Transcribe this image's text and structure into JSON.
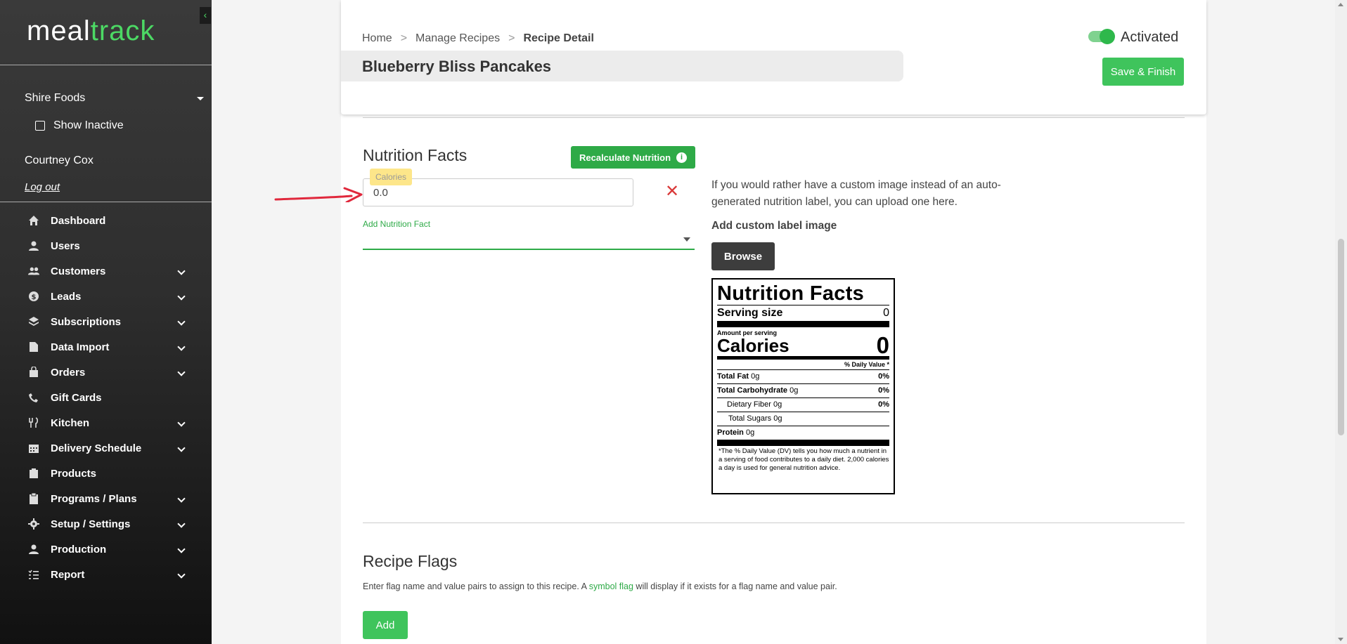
{
  "brand": {
    "prefix": "meal",
    "suffix": "track",
    "accent_color": "#4cd964"
  },
  "sidebar": {
    "collapse_glyph": "‹",
    "org": "Shire Foods",
    "show_inactive": "Show Inactive",
    "user": "Courtney Cox",
    "logout": "Log out",
    "items": [
      {
        "label": "Dashboard",
        "icon": "home-icon",
        "expandable": false
      },
      {
        "label": "Users",
        "icon": "user-icon",
        "expandable": false
      },
      {
        "label": "Customers",
        "icon": "users-icon",
        "expandable": true
      },
      {
        "label": "Leads",
        "icon": "dollar-icon",
        "expandable": true
      },
      {
        "label": "Subscriptions",
        "icon": "layers-icon",
        "expandable": true
      },
      {
        "label": "Data Import",
        "icon": "file-icon",
        "expandable": true
      },
      {
        "label": "Orders",
        "icon": "bag-icon",
        "expandable": true
      },
      {
        "label": "Gift Cards",
        "icon": "phone-icon",
        "expandable": false
      },
      {
        "label": "Kitchen",
        "icon": "utensils-icon",
        "expandable": true
      },
      {
        "label": "Delivery Schedule",
        "icon": "calendar-icon",
        "expandable": true
      },
      {
        "label": "Products",
        "icon": "box-icon",
        "expandable": false
      },
      {
        "label": "Programs / Plans",
        "icon": "clipboard-icon",
        "expandable": true
      },
      {
        "label": "Setup / Settings",
        "icon": "gear-icon",
        "expandable": true
      },
      {
        "label": "Production",
        "icon": "worker-icon",
        "expandable": true
      },
      {
        "label": "Report",
        "icon": "list-icon",
        "expandable": true
      }
    ]
  },
  "header": {
    "breadcrumb": {
      "home": "Home",
      "sep": ">",
      "manage": "Manage Recipes",
      "current": "Recipe Detail"
    },
    "title": "Blueberry Bliss Pancakes",
    "toggle_label": "Activated",
    "save_label": "Save & Finish"
  },
  "nutrition": {
    "heading": "Nutrition Facts",
    "recalc_label": "Recalculate Nutrition",
    "info_glyph": "i",
    "calories_label": "Calories",
    "calories_value": "0.0",
    "remove_glyph": "✕",
    "add_fact_label": "Add Nutrition Fact",
    "custom_text": "If you would rather have a custom image instead of an auto-generated nutrition label, you can upload one here.",
    "custom_label": "Add custom label image",
    "browse_label": "Browse"
  },
  "label": {
    "title": "Nutrition Facts",
    "serving_size": "Serving size",
    "serving_value": "0",
    "amount_per": "Amount per serving",
    "calories": "Calories",
    "calories_value": "0",
    "dv_header": "% Daily Value *",
    "rows": [
      {
        "name": "Total Fat",
        "amount": "0g",
        "dv": "0%"
      },
      {
        "name": "Total Carbohydrate",
        "amount": "0g",
        "dv": "0%"
      },
      {
        "name": "Dietary Fiber",
        "amount": "0g",
        "dv": "0%"
      },
      {
        "name": "Total Sugars",
        "amount": "0g",
        "dv": ""
      },
      {
        "name": "Protein",
        "amount": "0g",
        "dv": ""
      }
    ],
    "footnote": "*The % Daily Value (DV) tells you how much a nutrient in a serving of food contributes to a daily diet. 2,000 calories a day is used for general nutrition advice."
  },
  "flags": {
    "heading": "Recipe Flags",
    "desc_before": "Enter flag name and value pairs to assign to this recipe. A ",
    "desc_link": "symbol flag",
    "desc_after": " will display if it exists for a flag name and value pair.",
    "add_label": "Add"
  }
}
